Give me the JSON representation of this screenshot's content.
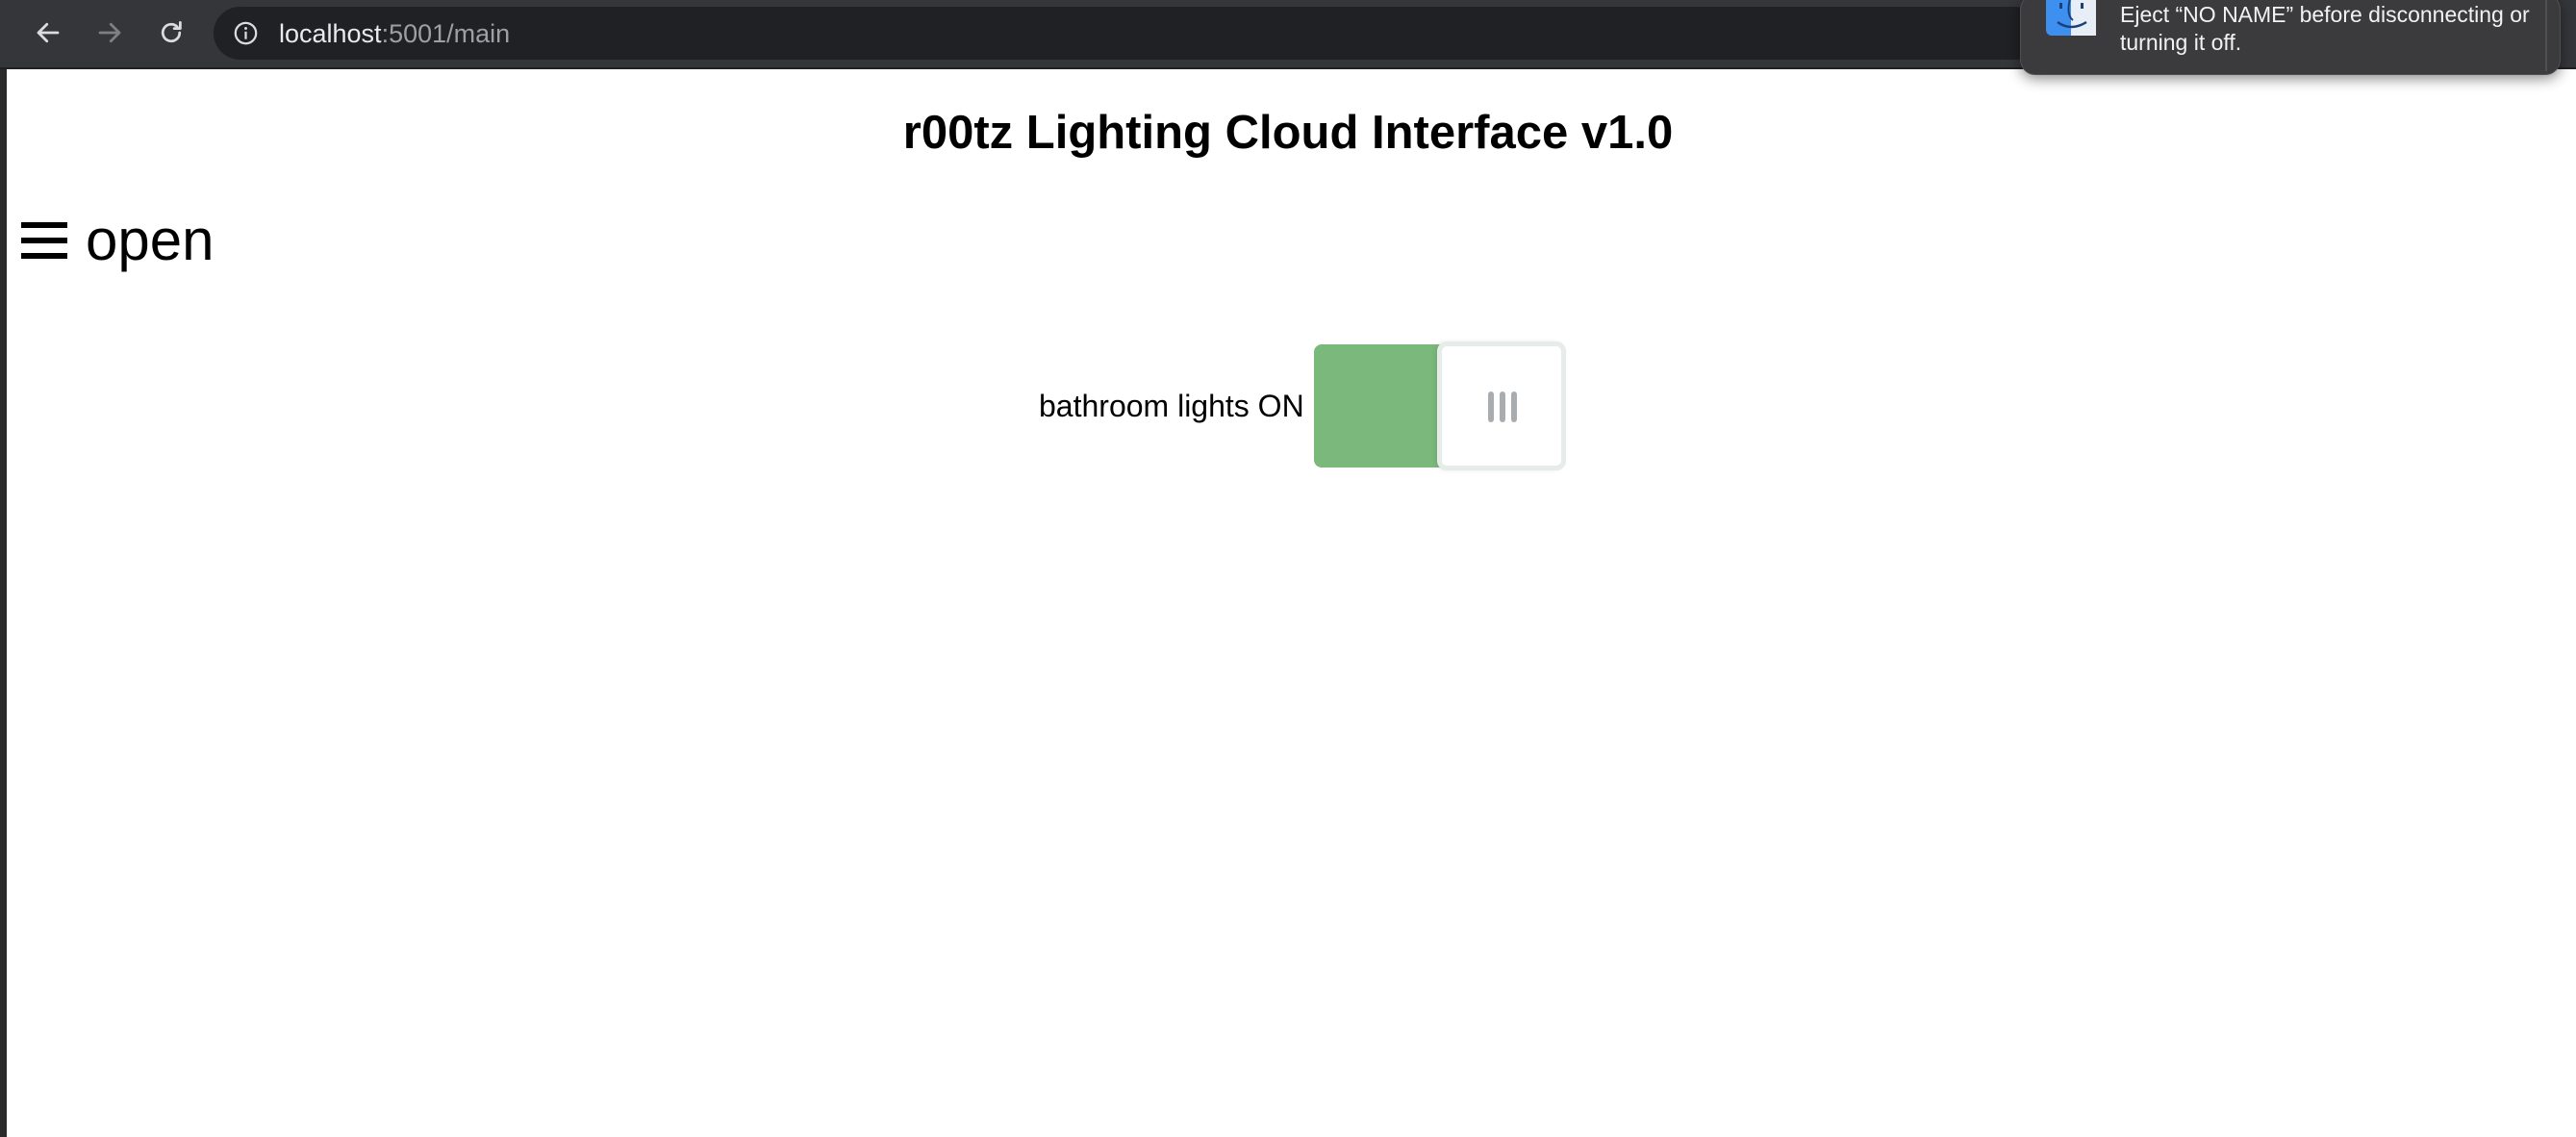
{
  "browser": {
    "url_host": "localhost",
    "url_rest": ":5001/main",
    "icons": {
      "back": "arrow-left-icon",
      "forward": "arrow-right-icon",
      "reload": "reload-icon",
      "site_info": "info-icon"
    }
  },
  "notification": {
    "text": "Eject “NO NAME” before disconnecting or turning it off.",
    "icon": "finder-icon"
  },
  "page": {
    "title": "r00tz Lighting Cloud Interface v1.0",
    "menu_label": "☰ open",
    "menu_text": "open",
    "switch_label": "bathroom lights ON",
    "switch_state": "on"
  },
  "colors": {
    "toolbar": "#35363a",
    "omnibox": "#202124",
    "switch_on": "#7bb87b",
    "knob_border": "#e6ece8",
    "grip": "#a9adb0"
  }
}
